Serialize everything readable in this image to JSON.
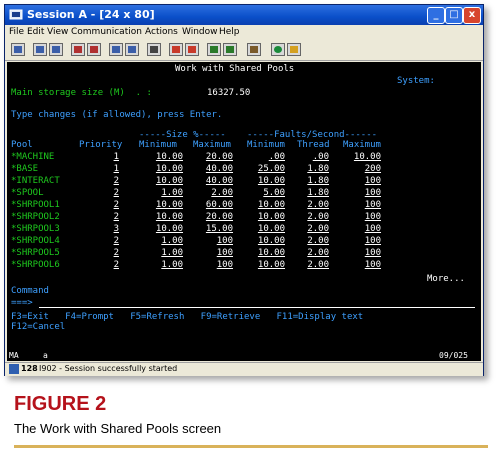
{
  "window": {
    "title": "Session A - [24 x 80]",
    "controls": {
      "minimize": "_",
      "maximize": "□",
      "close": "x"
    }
  },
  "menu": [
    "File",
    "Edit",
    "View",
    "Communication",
    "Actions",
    "Window",
    "Help"
  ],
  "toolbar": {
    "icon_names": [
      "print-screen-icon",
      "copy-icon",
      "paste-icon",
      "send-icon",
      "receive-icon",
      "display-icon",
      "keypad-icon",
      "record-icon",
      "stop-icon",
      "play-icon",
      "macro-icon",
      "color-icon",
      "globe-icon",
      "properties-icon"
    ]
  },
  "screen": {
    "title": "Work with Shared Pools",
    "system_label": "System:",
    "storage_label": "Main storage size (M)  . :",
    "storage_value": "16327.50",
    "instruction": "Type changes (if allowed), press Enter.",
    "group_size": "-----Size %-----",
    "group_faults": "-----Faults/Second------",
    "col_pool": "Pool",
    "col_priority": "Priority",
    "col_size_min": "Minimum",
    "col_size_max": "Maximum",
    "col_fault_min": "Minimum",
    "col_thread": "Thread",
    "col_fault_max": "Maximum",
    "rows": [
      {
        "pool": "*MACHINE",
        "priority": "1",
        "size_min": "10.00",
        "size_max": "20.00",
        "fault_min": ".00",
        "thread": ".00",
        "fault_max": "10.00"
      },
      {
        "pool": "*BASE",
        "priority": "1",
        "size_min": "10.00",
        "size_max": "40.00",
        "fault_min": "25.00",
        "thread": "1.80",
        "fault_max": "200"
      },
      {
        "pool": "*INTERACT",
        "priority": "2",
        "size_min": "10.00",
        "size_max": "40.00",
        "fault_min": "10.00",
        "thread": "1.80",
        "fault_max": "100"
      },
      {
        "pool": "*SPOOL",
        "priority": "2",
        "size_min": "1.00",
        "size_max": "2.00",
        "fault_min": "5.00",
        "thread": "1.80",
        "fault_max": "100"
      },
      {
        "pool": "*SHRPOOL1",
        "priority": "2",
        "size_min": "10.00",
        "size_max": "60.00",
        "fault_min": "10.00",
        "thread": "2.00",
        "fault_max": "100"
      },
      {
        "pool": "*SHRPOOL2",
        "priority": "2",
        "size_min": "10.00",
        "size_max": "20.00",
        "fault_min": "10.00",
        "thread": "2.00",
        "fault_max": "100"
      },
      {
        "pool": "*SHRPOOL3",
        "priority": "3",
        "size_min": "10.00",
        "size_max": "15.00",
        "fault_min": "10.00",
        "thread": "2.00",
        "fault_max": "100"
      },
      {
        "pool": "*SHRPOOL4",
        "priority": "2",
        "size_min": "1.00",
        "size_max": "100",
        "fault_min": "10.00",
        "thread": "2.00",
        "fault_max": "100"
      },
      {
        "pool": "*SHRPOOL5",
        "priority": "2",
        "size_min": "1.00",
        "size_max": "100",
        "fault_min": "10.00",
        "thread": "2.00",
        "fault_max": "100"
      },
      {
        "pool": "*SHRPOOL6",
        "priority": "2",
        "size_min": "1.00",
        "size_max": "100",
        "fault_min": "10.00",
        "thread": "2.00",
        "fault_max": "100"
      }
    ],
    "more": "More...",
    "command_label": "Command",
    "prompt": "===>",
    "fkeys_line1": "F3=Exit   F4=Prompt   F5=Refresh   F9=Retrieve   F11=Display text",
    "fkeys_line2": "F12=Cancel"
  },
  "oia": {
    "left": "MA",
    "mode": "a",
    "cursor": "09/025"
  },
  "status": {
    "number": "128",
    "message": "I902 - Session successfully started"
  },
  "caption": {
    "figure": "FIGURE 2",
    "text": "The Work with Shared Pools screen"
  },
  "colors": {
    "screen_bg": "#000000",
    "green": "#1ec81e",
    "blue": "#3ea0ff",
    "white": "#ffffff",
    "caption_red": "#b5121b",
    "rule_gold": "#d9b25a"
  }
}
